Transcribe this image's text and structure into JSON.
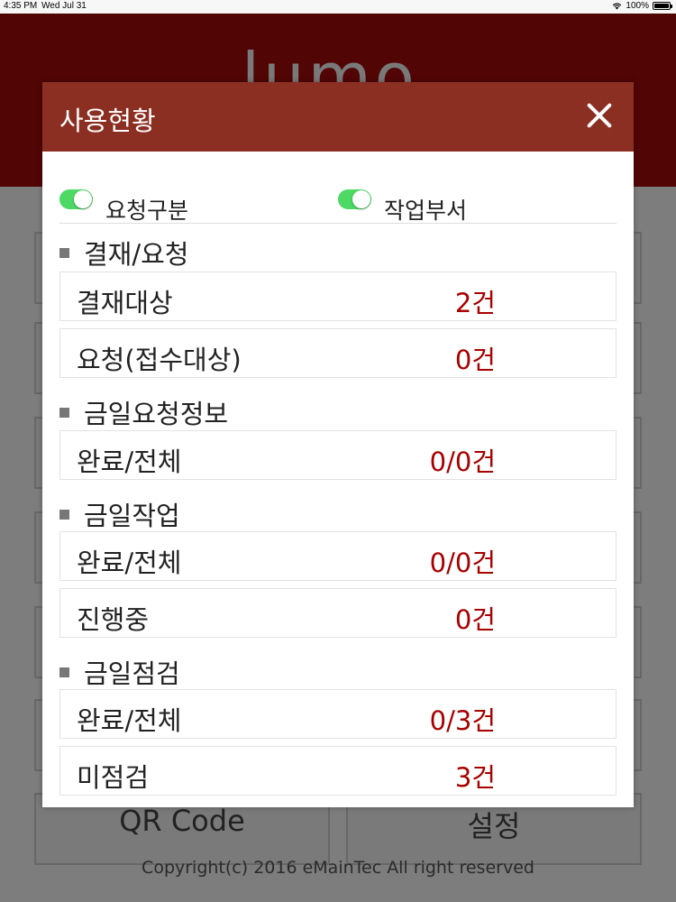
{
  "statusbar": {
    "time": "4:35 PM",
    "date": "Wed Jul 31",
    "battery": "100%"
  },
  "app": {
    "logo": "lumo",
    "tiles": [
      "QR Code",
      "설정"
    ],
    "copyright": "Copyright(c) 2016 eMainTec All right reserved"
  },
  "modal": {
    "title": "사용현황",
    "toggles": [
      {
        "label": "요청구분",
        "on": true
      },
      {
        "label": "작업부서",
        "on": true
      }
    ],
    "sections": [
      {
        "title": "결재/요청",
        "rows": [
          {
            "label": "결재대상",
            "value": "2건"
          },
          {
            "label": "요청(접수대상)",
            "value": "0건"
          }
        ]
      },
      {
        "title": "금일요청정보",
        "rows": [
          {
            "label": "완료/전체",
            "value": "0/0건"
          }
        ]
      },
      {
        "title": "금일작업",
        "rows": [
          {
            "label": "완료/전체",
            "value": "0/0건"
          },
          {
            "label": "진행중",
            "value": "0건"
          }
        ]
      },
      {
        "title": "금일점검",
        "rows": [
          {
            "label": "완료/전체",
            "value": "0/3건"
          },
          {
            "label": "미점검",
            "value": "3건"
          }
        ]
      }
    ]
  },
  "colors": {
    "header": "#a20a0a",
    "modal_header": "#8c2f23",
    "value": "#a80000",
    "toggle_on": "#4cd964"
  }
}
